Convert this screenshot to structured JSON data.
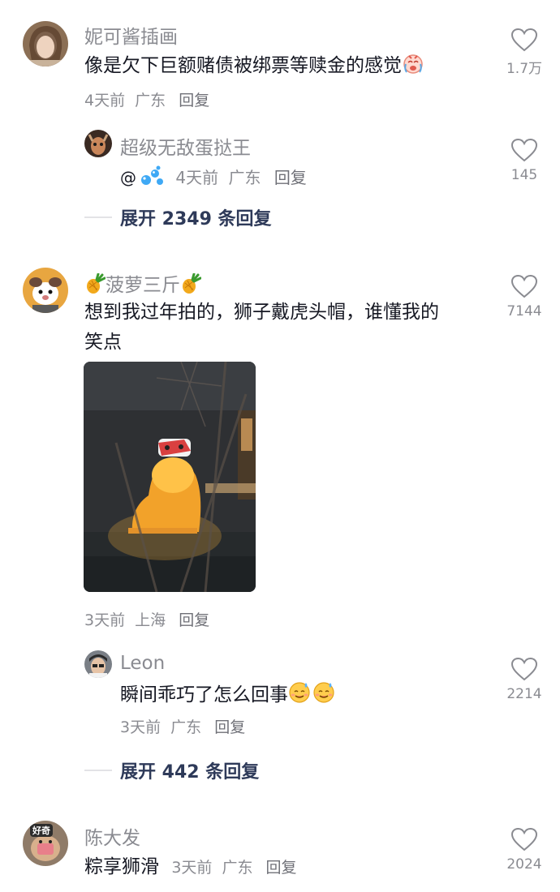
{
  "comments": [
    {
      "user": "妮可酱插画",
      "text": "像是欠下巨额赌债被绑票等赎金的感觉",
      "time": "4天前",
      "location": "广东",
      "reply_label": "回复",
      "likes": "1.7万",
      "emoji": "crying-face",
      "replies": [
        {
          "user": "超级无敌蛋挞王",
          "prefix": "@",
          "time": "4天前",
          "location": "广东",
          "reply_label": "回复",
          "likes": "145",
          "emoji": "water-drops"
        }
      ],
      "expand_label": "展开 2349 条回复"
    },
    {
      "user": "菠萝三斤",
      "user_decor": "pineapple",
      "text_line1": "想到我过年拍的，狮子戴虎头帽，谁懂我的",
      "text_line2": "笑点",
      "time": "3天前",
      "location": "上海",
      "reply_label": "回复",
      "likes": "7144",
      "photo": "lion-statue-night-photo",
      "replies": [
        {
          "user": "Leon",
          "text": "瞬间乖巧了怎么回事",
          "emoji": "sweat-smile",
          "time": "3天前",
          "location": "广东",
          "reply_label": "回复",
          "likes": "2214"
        }
      ],
      "expand_label": "展开 442 条回复"
    },
    {
      "user": "陈大发",
      "text": "粽享狮滑",
      "time": "3天前",
      "location": "广东",
      "reply_label": "回复",
      "likes": "2024",
      "avatar_badge": "好奇"
    }
  ],
  "colors": {
    "meta": "#8a8b91",
    "text": "#161823",
    "expand": "#2e3a59"
  }
}
